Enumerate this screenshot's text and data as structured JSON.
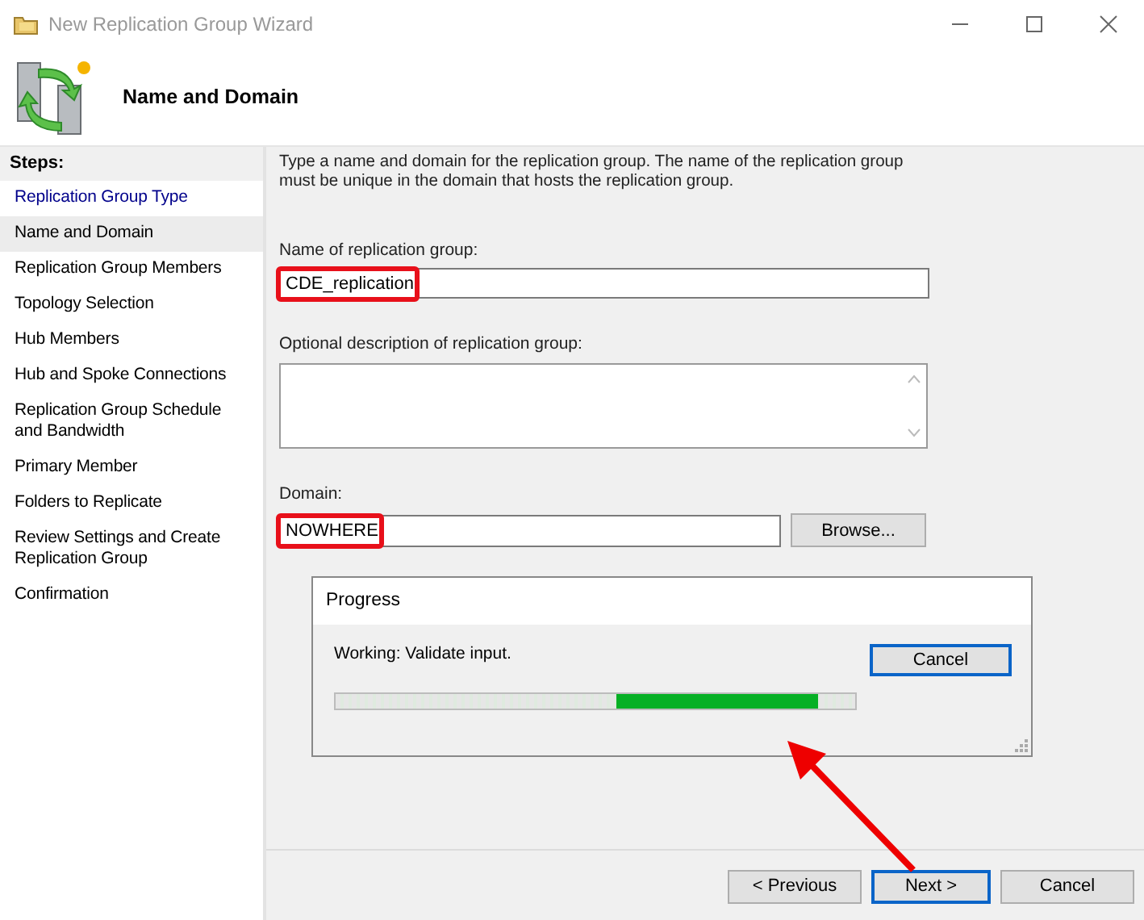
{
  "window": {
    "title": "New Replication Group Wizard"
  },
  "header": {
    "title": "Name and Domain"
  },
  "steps": {
    "heading": "Steps:",
    "items": [
      {
        "label": "Replication Group Type",
        "selected": false,
        "completed": true
      },
      {
        "label": "Name and Domain",
        "selected": true,
        "completed": false
      },
      {
        "label": "Replication Group Members",
        "selected": false,
        "completed": false
      },
      {
        "label": "Topology Selection",
        "selected": false,
        "completed": false
      },
      {
        "label": "Hub Members",
        "selected": false,
        "completed": false
      },
      {
        "label": "Hub and Spoke Connections",
        "selected": false,
        "completed": false
      },
      {
        "label": "Replication Group Schedule and Bandwidth",
        "selected": false,
        "completed": false
      },
      {
        "label": "Primary Member",
        "selected": false,
        "completed": false
      },
      {
        "label": "Folders to Replicate",
        "selected": false,
        "completed": false
      },
      {
        "label": "Review Settings and Create Replication Group",
        "selected": false,
        "completed": false
      },
      {
        "label": "Confirmation",
        "selected": false,
        "completed": false
      }
    ]
  },
  "intro": "Type a name and domain for the replication group. The name of the replication group must be unique in the domain that hosts the replication group.",
  "name_field": {
    "label": "Name of replication group:",
    "value": "CDE_replication",
    "highlighted": true
  },
  "description_field": {
    "label": "Optional description of replication group:"
  },
  "domain_field": {
    "label": "Domain:",
    "value": "NOWHERE",
    "highlighted": true,
    "button": "Browse..."
  },
  "progress_dialog": {
    "title": "Progress",
    "status": "Working: Validate input.",
    "button": "Cancel",
    "progress": {
      "kind": "marquee"
    }
  },
  "buttons": [
    {
      "label": "< Previous",
      "default": false
    },
    {
      "label": "Next >",
      "default": true
    },
    {
      "label": "Cancel",
      "default": false
    }
  ]
}
